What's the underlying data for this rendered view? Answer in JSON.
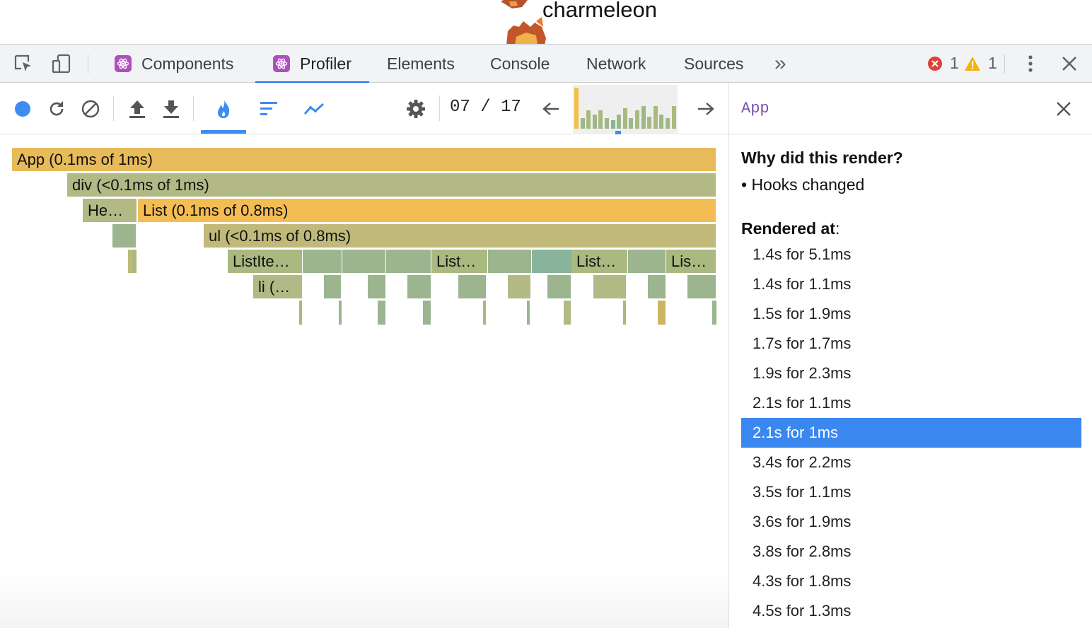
{
  "page": {
    "heading": "charmeleon"
  },
  "devtools": {
    "tabs": [
      {
        "label": "Components",
        "react": true
      },
      {
        "label": "Profiler",
        "react": true,
        "active": true
      },
      {
        "label": "Elements"
      },
      {
        "label": "Console"
      },
      {
        "label": "Network"
      },
      {
        "label": "Sources"
      }
    ],
    "more_tabs": "»",
    "error_count": "1",
    "warning_count": "1",
    "icons": [
      "inspect-element-icon",
      "device-toolbar-icon",
      "more-tabs-icon",
      "error-icon",
      "warning-icon",
      "kebab-menu-icon",
      "close-devtools-icon"
    ],
    "colors": {
      "active_tab": "#1a73e8",
      "error": "#e0403a",
      "warning": "#f2b310"
    }
  },
  "profiler": {
    "toolbar_icons": [
      "record-icon",
      "reload-and-profile-icon",
      "clear-icon",
      "load-profile-icon",
      "save-profile-icon",
      "flamegraph-icon",
      "ranked-icon",
      "timeline-icon",
      "settings-icon",
      "prev-commit-icon",
      "next-commit-icon"
    ],
    "commit_current": "07",
    "commit_total": "17",
    "commit_counter": "07 / 17",
    "commit_chart": {
      "selected_index": 6,
      "bars": [
        {
          "height": 1.0,
          "color": "#f0bf4c"
        },
        {
          "height": 0.25,
          "color": "#9cb888"
        },
        {
          "height": 0.45,
          "color": "#a9b97f"
        },
        {
          "height": 0.35,
          "color": "#9cb888"
        },
        {
          "height": 0.45,
          "color": "#a9b97f"
        },
        {
          "height": 0.25,
          "color": "#9cb888"
        },
        {
          "height": 0.2,
          "color": "#89b39a"
        },
        {
          "height": 0.35,
          "color": "#9cb888"
        },
        {
          "height": 0.5,
          "color": "#a9b97f"
        },
        {
          "height": 0.25,
          "color": "#9cb888"
        },
        {
          "height": 0.45,
          "color": "#a9b97f"
        },
        {
          "height": 0.55,
          "color": "#9cb888"
        },
        {
          "height": 0.3,
          "color": "#a9b97f"
        },
        {
          "height": 0.55,
          "color": "#a9b97f"
        },
        {
          "height": 0.35,
          "color": "#9cb888"
        },
        {
          "height": 0.25,
          "color": "#9cb888"
        },
        {
          "height": 0.55,
          "color": "#a9b97f"
        }
      ]
    }
  },
  "flamegraph": {
    "bars": [
      {
        "label": "App (0.1ms of 1ms)",
        "color": "#e8bb5a"
      },
      {
        "label": "div (<0.1ms of 1ms)",
        "color": "#b2b985"
      },
      {
        "label": "He…",
        "color": "#b2b985"
      },
      {
        "label": "List (0.1ms of 0.8ms)",
        "color": "#f4bd53"
      },
      {
        "label": "",
        "color": "#9cb58f"
      },
      {
        "label": "ul (<0.1ms of 0.8ms)",
        "color": "#c0b979"
      },
      {
        "label": "",
        "color": "#c0b979"
      },
      {
        "label": "",
        "color": "#a9b97f"
      },
      {
        "label": "ListIte…",
        "color": "#a9b97f"
      },
      {
        "label": "",
        "color": "#9cb58f"
      },
      {
        "label": "",
        "color": "#9cb58f"
      },
      {
        "label": "",
        "color": "#9cb58f"
      },
      {
        "label": "List…",
        "color": "#a9b97f"
      },
      {
        "label": "",
        "color": "#9cb58f"
      },
      {
        "label": "",
        "color": "#89b39a"
      },
      {
        "label": "List…",
        "color": "#a9b97f"
      },
      {
        "label": "",
        "color": "#9cb58f"
      },
      {
        "label": "Lis…",
        "color": "#a9b97f"
      },
      {
        "label": "li (…",
        "color": "#b2b985"
      },
      {
        "label": "",
        "color": "#9cb58f"
      },
      {
        "label": "",
        "color": "#9cb58f"
      },
      {
        "label": "",
        "color": "#9cb58f"
      },
      {
        "label": "",
        "color": "#9cb58f"
      },
      {
        "label": "",
        "color": "#b2b985"
      },
      {
        "label": "",
        "color": "#9cb58f"
      },
      {
        "label": "",
        "color": "#b2b985"
      },
      {
        "label": "",
        "color": "#9cb58f"
      },
      {
        "label": "",
        "color": "#9cb58f"
      }
    ],
    "leaf_colors": [
      "#a9b97f",
      "#9cb58f",
      "#9cb58f",
      "#9cb58f",
      "#a9b97f",
      "#9cb58f",
      "#b2b985",
      "#a9b97f",
      "#c8b662",
      "#9cb58f"
    ]
  },
  "side_panel": {
    "title": "App",
    "why_heading": "Why did this render?",
    "why_reason": "• Hooks changed",
    "rendered_heading": "Rendered at",
    "rendered_heading_suffix": ":",
    "selected_index": 6,
    "renders": [
      "1.4s for 5.1ms",
      "1.4s for 1.1ms",
      "1.5s for 1.9ms",
      "1.7s for 1.7ms",
      "1.9s for 2.3ms",
      "2.1s for 1.1ms",
      "2.1s for 1ms",
      "3.4s for 2.2ms",
      "3.5s for 1.1ms",
      "3.6s for 1.9ms",
      "3.8s for 2.8ms",
      "4.3s for 1.8ms",
      "4.5s for 1.3ms"
    ],
    "colors": {
      "selected": "#3a87f0",
      "title": "#7a4fb4"
    }
  }
}
